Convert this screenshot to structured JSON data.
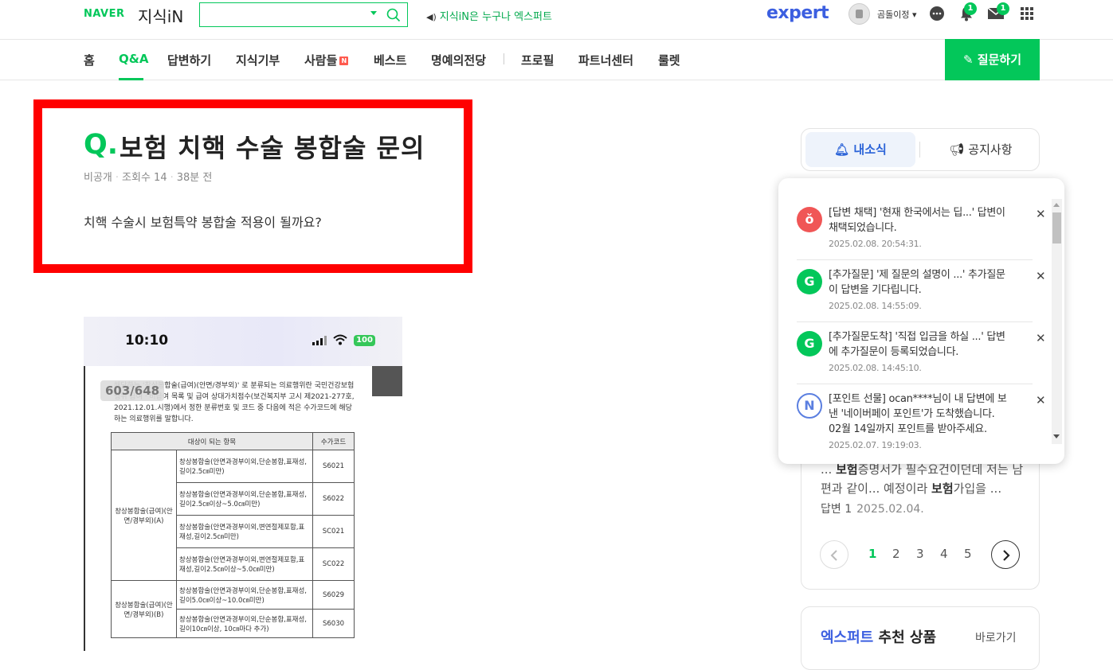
{
  "header": {
    "naver_logo": "NAVER",
    "kin_logo": "지식iN",
    "search_placeholder": "",
    "slogan": "지식iN은 누구나 엑스퍼트",
    "expert_logo": "expert",
    "username": "곰돌이정",
    "notification_count": "1",
    "mail_count": "1"
  },
  "nav": {
    "items": [
      "홈",
      "Q&A",
      "답변하기",
      "지식기부",
      "사람들",
      "베스트",
      "명예의전당",
      "프로필",
      "파트너센터",
      "룰렛"
    ],
    "new_badge": "N",
    "ask_button": "질문하기"
  },
  "question": {
    "mark": "Q.",
    "title": "보험 치핵 수술 봉합술 문의",
    "visibility": "비공개",
    "views": "조회수 14",
    "time": "38분 전",
    "body": "치핵 수술시 보험특약 봉합술 적용이 될까요?"
  },
  "attachment": {
    "phone_time": "10:10",
    "battery": "100",
    "page_counter": "603/648",
    "paragraph": "해당하는 '창상봉합술(급여)(안면/경부외)' 로 분류되는 의료행위란 국민건강보험 행위 급여ㆍ비급여 목록 및 급여 상대가치점수(보건복지부 고시 제2021-277호, 2021.12.01.시행)에서 정한 분류번호 및 코드 중 다음에 적은 수가코드에 해당하는 의료행위를 말합니다.",
    "table_headers": [
      "대상이 되는 항목",
      "수가코드"
    ],
    "group_a": "창상봉합술(급여)(안면/경부외)(A)",
    "group_b": "창상봉합술(급여)(안면/경부외)(B)",
    "rows": [
      {
        "item": "창상봉합술(안면과경부이외,단순봉합,표재성,길이2.5㎝미만)",
        "code": "S6021"
      },
      {
        "item": "창상봉합술(안면과경부이외,단순봉합,표재성,길이2.5㎝이상~5.0㎝미만)",
        "code": "S6022"
      },
      {
        "item": "창상봉합술(안면과경부이외,변연절제포함,표재성,길이2.5㎝미만)",
        "code": "SC021"
      },
      {
        "item": "창상봉합술(안면과경부이외,변연절제포함,표재성,길이2.5㎝이상~5.0㎝미만)",
        "code": "SC022"
      },
      {
        "item": "창상봉합술(안면과경부이외,단순봉합,표재성,길이5.0㎝이상~10.0㎝미만)",
        "code": "S6029"
      },
      {
        "item": "창상봉합술(안면과경부이외,단순봉합,표재성,길이10㎝이상, 10㎝마다 추가)",
        "code": "S6030"
      }
    ]
  },
  "sidebar": {
    "tab_news": "내소식",
    "tab_notice": "공지사항",
    "related_snippet_pre": "... ",
    "related_snippet_bold1": "보험",
    "related_snippet_mid": "증명서가 필수요건이던데 저는 남편과 같이... 예정이라 ",
    "related_snippet_bold2": "보험",
    "related_snippet_post": "가입을 ...",
    "answer_label": "답변 1",
    "answer_date": "2025.02.04.",
    "pages": [
      "1",
      "2",
      "3",
      "4",
      "5"
    ],
    "expert_title_blue": "엑스퍼트",
    "expert_title_rest": " 추천 상품",
    "expert_more": "바로가기"
  },
  "notifications": [
    {
      "icon": "ℊ",
      "color": "#f05656",
      "text": "[답변 채택] '현재 한국에서는 딥...' 답변이 채택되었습니다.",
      "time": "2025.02.08. 20:54:31."
    },
    {
      "icon": "G+",
      "color": "#03c75a",
      "text": "[추가질문] '제 질문의 설명이 ...' 추가질문이 답변을 기다립니다.",
      "time": "2025.02.08. 14:55:09."
    },
    {
      "icon": "G+",
      "color": "#03c75a",
      "text": "[추가질문도착] '직접 입금을 하실 ...' 답변에 추가질문이 등록되었습니다.",
      "time": "2025.02.08. 14:45:10."
    },
    {
      "icon": "N",
      "color": "#5b7fe0",
      "text": "[포인트 선물] ocan****님이 내 답변에 보낸 '네이버페이 포인트'가 도착했습니다. 02월 14일까지 포인트를 받아주세요.",
      "time": "2025.02.07. 19:19:03."
    }
  ],
  "colors": {
    "accent": "#03c75a",
    "highlight": "#ff0000",
    "expert": "#3c5fe0"
  }
}
